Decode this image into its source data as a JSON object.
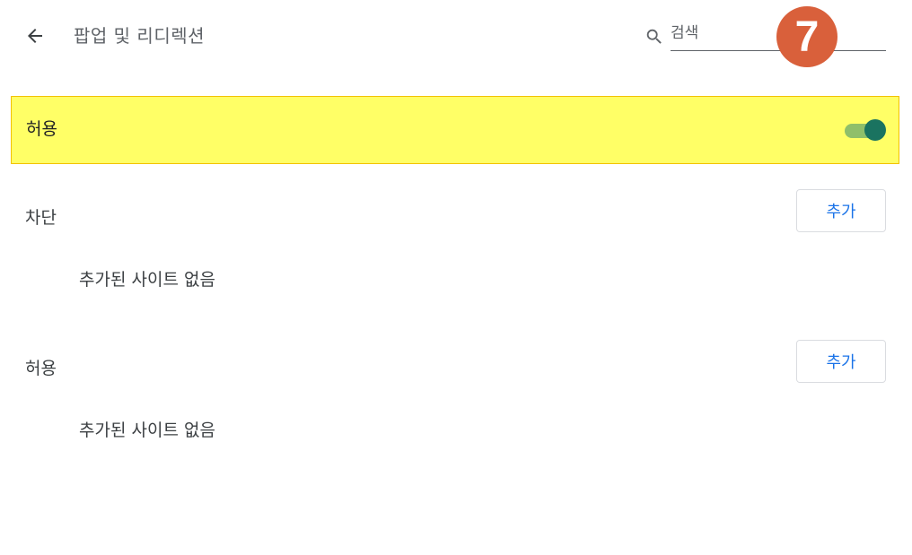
{
  "header": {
    "title": "팝업 및 리디렉션",
    "search_placeholder": "검색",
    "step_number": "7"
  },
  "toggle_row": {
    "label": "허용",
    "enabled": true
  },
  "sections": [
    {
      "label": "차단",
      "add_label": "추가",
      "empty_text": "추가된 사이트 없음"
    },
    {
      "label": "허용",
      "add_label": "추가",
      "empty_text": "추가된 사이트 없음"
    }
  ],
  "colors": {
    "highlight": "#ffff66",
    "toggle_track": "#8fbf6a",
    "toggle_knob": "#1a7360",
    "button_text": "#1a73e8",
    "badge": "#d9603b"
  }
}
